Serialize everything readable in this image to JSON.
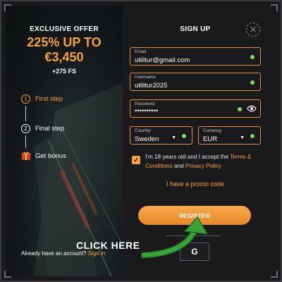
{
  "offer": {
    "label": "EXCLUSIVE OFFER",
    "headline_line1": "225% UP TO",
    "headline_line2": "€3,450",
    "free_spins": "+275 FS"
  },
  "steps": [
    {
      "number": "1",
      "label": "First step",
      "active": true
    },
    {
      "number": "2",
      "label": "Final step",
      "active": false
    },
    {
      "icon": "gift-icon",
      "label": "Get bonus",
      "active": false
    }
  ],
  "account_prompt": {
    "text": "Already have an account?",
    "link": "Sign in"
  },
  "form": {
    "title": "SIGN UP",
    "email": {
      "label": "Email",
      "value": "utilitur@gmail.com"
    },
    "username": {
      "label": "Username",
      "value": "utilitur2025"
    },
    "password": {
      "label": "Password",
      "value": "••••••••••"
    },
    "country": {
      "label": "Country",
      "value": "Sweden"
    },
    "currency": {
      "label": "Currency",
      "value": "EUR"
    },
    "terms": {
      "checked": true,
      "text_before": "I'm 18 years old and I accept the ",
      "terms_link": "Terms & Conditions",
      "and": " and ",
      "privacy_link": "Privacy Policy"
    },
    "promo_link": "I have a promo code",
    "register_label": "REGISTER",
    "google_label": "G"
  },
  "overlay": {
    "click_here": "CLICK HERE"
  },
  "colors": {
    "accent": "#f5a23c",
    "field_border": "#e8902f",
    "valid": "#7ed957",
    "arrow": "#2e8b2e"
  }
}
